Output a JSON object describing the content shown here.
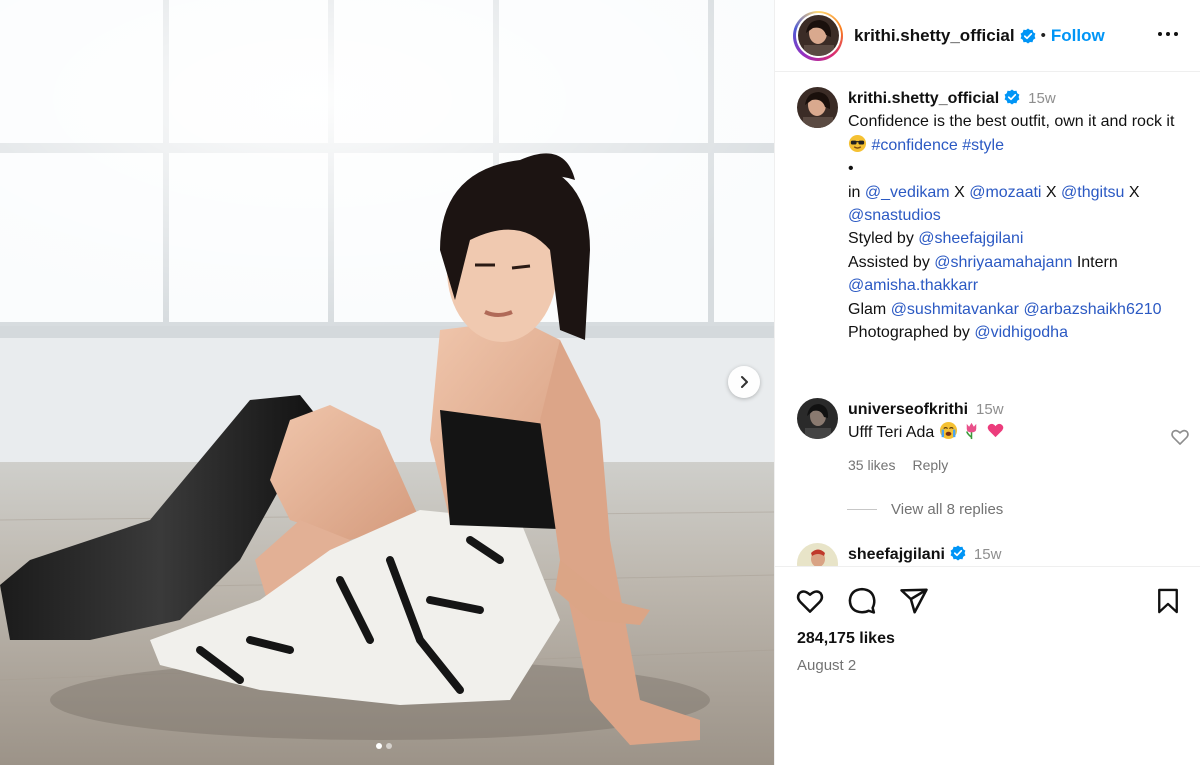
{
  "post": {
    "username": "krithi.shetty_official",
    "follow_label": "Follow",
    "separator": "•",
    "likes": "284,175 likes",
    "date": "August 2",
    "carousel": {
      "slide_count": 2,
      "active_slide": 1
    }
  },
  "caption": {
    "username": "krithi.shetty_official",
    "timestamp": "15w",
    "line1": "Confidence is the best outfit, own it and rock it",
    "hashtag_confidence": "#confidence",
    "hashtag_style": "#style",
    "bullet": "•",
    "in_prefix": "in",
    "mention_vedikam": "@_vedikam",
    "x1": "X",
    "mention_mozaati": "@mozaati",
    "x2": "X",
    "mention_thgitsu": "@thgitsu",
    "x3": "X",
    "mention_snastudios": "@snastudios",
    "styled_by": "Styled by",
    "mention_sheefajgilani": "@sheefajgilani",
    "assisted_by": "Assisted by",
    "mention_shriyaamahajann": "@shriyaamahajann",
    "intern": "Intern",
    "mention_amisha": "@amisha.thakkarr",
    "glam": "Glam",
    "mention_sushmitavankar": "@sushmitavankar",
    "mention_arbaz": "@arbazshaikh6210",
    "photographed_by": "Photographed by",
    "mention_vidhigodha": "@vidhigodha"
  },
  "comments": [
    {
      "username": "universeofkrithi",
      "timestamp": "15w",
      "text": "Ufff Teri Ada",
      "likes": "35 likes",
      "reply_label": "Reply",
      "view_replies": "View all 8 replies"
    },
    {
      "username": "sheefajgilani",
      "timestamp": "15w"
    }
  ],
  "colors": {
    "follow_blue": "#0095f6",
    "mention_blue": "#2b59c3",
    "verified_blue": "#0095f6",
    "secondary_text": "#737373"
  },
  "icons": [
    "verified-badge-icon",
    "more-options-icon",
    "chevron-right-icon",
    "heart-icon",
    "comment-icon",
    "share-icon",
    "bookmark-icon",
    "emoji-sunglasses-icon",
    "emoji-crying-face-icon",
    "emoji-tulip-icon",
    "emoji-pink-heart-icon"
  ]
}
